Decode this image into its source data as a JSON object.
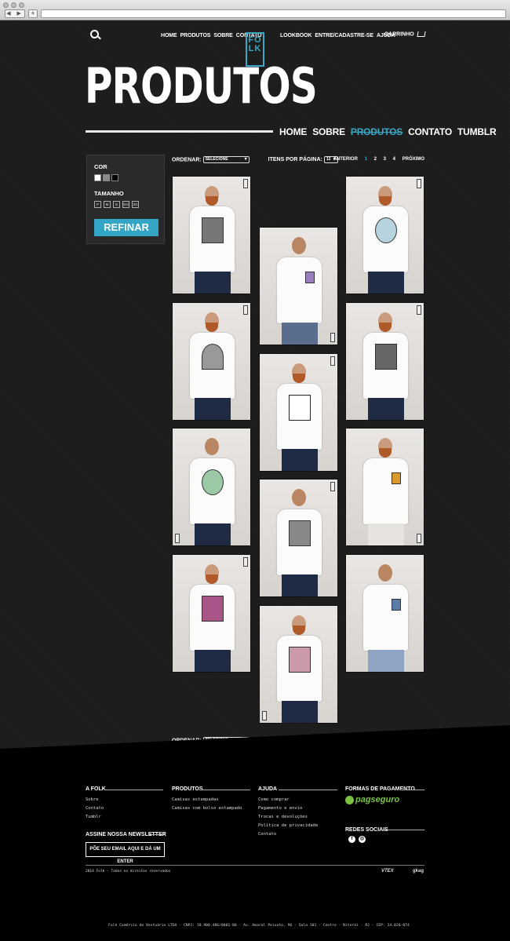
{
  "browser": {
    "nav_arrows": "◀ ▶",
    "new_tab": "+"
  },
  "header": {
    "nav_left": [
      "HOME",
      "PRODUTOS",
      "SOBRE",
      "CONTATO"
    ],
    "logo": "FO LK",
    "nav_right": [
      "LOOKBOOK",
      "ENTRE/CADASTRE-SE",
      "AJUDA"
    ],
    "cart": "CARRINHO"
  },
  "page_title": "PRODUTOS",
  "section_nav": {
    "items": [
      "HOME",
      "SOBRE",
      "PRODUTOS",
      "CONTATO",
      "TUMBLR"
    ],
    "active": "PRODUTOS"
  },
  "filters": {
    "color_label": "COR",
    "colors": [
      "#ffffff",
      "#8a8a8a",
      "#000000"
    ],
    "size_label": "TAMANHO",
    "sizes": [
      "P",
      "M",
      "G",
      "GG",
      "3G"
    ],
    "refine": "REFINAR"
  },
  "toolbar": {
    "sort_label": "ORDENAR:",
    "sort_value": "SELECIONE",
    "per_page_label": "ITENS POR PÁGINA:",
    "per_page_value": "12",
    "prev": "ANTERIOR",
    "pages": [
      "1",
      "2",
      "3",
      "4"
    ],
    "current_page": "1",
    "next": "PRÓXIMO"
  },
  "footer": {
    "col1": {
      "title": "A FOLK",
      "links": [
        "Sobre",
        "Contato",
        "Tumblr"
      ]
    },
    "col2": {
      "title": "PRODUTOS",
      "links": [
        "Camisas estampadas",
        "Camisas com bolso estampado"
      ]
    },
    "col3": {
      "title": "AJUDA",
      "links": [
        "Como comprar",
        "Pagamento e envio",
        "Trocas e devoluções",
        "Política de privacidade",
        "Contato"
      ]
    },
    "col4": {
      "title": "FORMAS DE PAGAMENTO",
      "pay": "pagseguro",
      "social_title": "REDES SOCIAIS"
    },
    "newsletter_title": "ASSINE NOSSA NEWSLETTER",
    "newsletter_button": "PÕE SEU EMAIL AQUI E DÁ UM ENTER",
    "copyright": "2014 Folk - Todos os direitos reservados",
    "brand1": "VTEX",
    "brand2": "gkag",
    "legal": "Folk Comércio de Vestuário LTDA - CNPJ: 18.900.486/0001-80 - Av. Amaral Peixoto, 96 - Sala 101 - Centro - Niterói - RJ - CEP: 24.020-074"
  }
}
